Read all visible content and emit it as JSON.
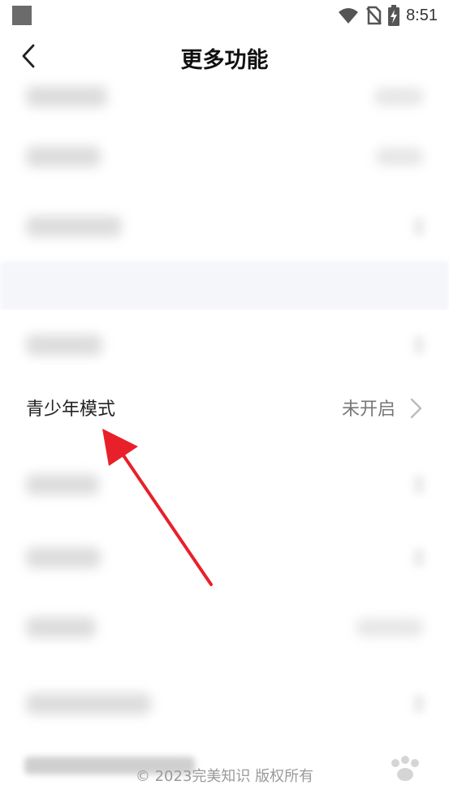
{
  "status_bar": {
    "time": "8:51"
  },
  "header": {
    "title": "更多功能"
  },
  "focused_item": {
    "label": "青少年模式",
    "value": "未开启"
  },
  "footer": {
    "copyright": "© 2023完美知识 版权所有"
  }
}
